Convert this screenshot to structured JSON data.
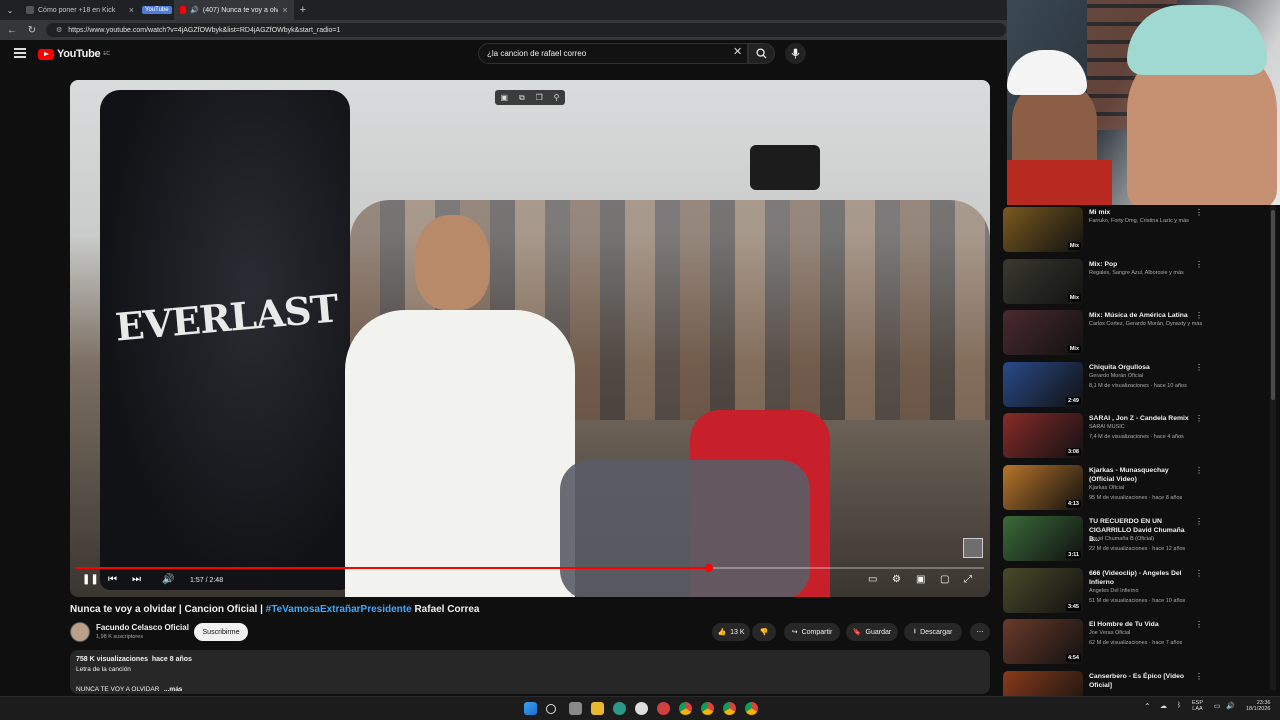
{
  "browser": {
    "tabs": [
      {
        "label": "Cómo poner +18 en Kick",
        "active": false
      },
      {
        "label": "YouTube",
        "active": false
      },
      {
        "label": "(407) Nunca te voy a olvidar |",
        "active": true
      }
    ],
    "url": "https://www.youtube.com/watch?v=4jAGZfOWbyk&list=RD4jAGZfOWbyk&start_radio=1"
  },
  "header": {
    "logo": "YouTube",
    "region": "EC",
    "search_query": "¿la cancion de rafael correo"
  },
  "player": {
    "bag_brand": "EVERLAST",
    "time_display": "1:57 / 2:48",
    "progress": 0.697
  },
  "video": {
    "title_prefix": "Nunca te voy a olvidar | Cancion Oficial | ",
    "hashtag": "#TeVamosaExtrañarPresidente",
    "title_suffix": " Rafael Correa",
    "channel": "Facundo Celasco Oficial",
    "subscribers": "1,98 K suscriptores",
    "subscribe_label": "Suscribirme",
    "likes": "13 K",
    "share_label": "Compartir",
    "save_label": "Guardar",
    "download_label": "Descargar",
    "views": "758 K visualizaciones",
    "age": "hace 8 años",
    "desc_line1": "Letra de la canción",
    "desc_line2": "NUNCA TE VOY A OLVIDAR",
    "more_label": "...más"
  },
  "recommendations": [
    {
      "title": "Mi mix",
      "channel": "Farruko, Forty Dmg, Cristina Lazic y más",
      "meta": "",
      "duration": "Mix",
      "color": "#7a5a1e"
    },
    {
      "title": "Mix: Pop",
      "channel": "Regales, Sangre Azul, Alborosie y más",
      "meta": "",
      "duration": "Mix",
      "color": "#3a3a30"
    },
    {
      "title": "Mix: Música de América Latina",
      "channel": "Carlos Cortez, Gerardo Morán, Dynasty y más",
      "meta": "",
      "duration": "Mix",
      "color": "#4a2a30"
    },
    {
      "title": "Chiquita Orgullosa",
      "channel": "Gerardo Morán Oficial",
      "meta": "8,1 M de visualizaciones · hace 10 años",
      "duration": "2:49",
      "color": "#2a4a8a"
    },
    {
      "title": "SARAI , Jon Z - Candela Remix",
      "channel": "SARAI MUSIC",
      "meta": "7,4 M de visualizaciones · hace 4 años",
      "duration": "3:08",
      "color": "#8a2a2a"
    },
    {
      "title": "Kjarkas - Munasquechay (Official Video)",
      "channel": "Kjarkas Oficial",
      "meta": "95 M de visualizaciones · hace 8 años",
      "duration": "4:13",
      "color": "#b8742a"
    },
    {
      "title": "TU RECUERDO EN UN CIGARRILLO David Chumaña B...",
      "channel": "David Chumaña B (Oficial)",
      "meta": "22 M de visualizaciones · hace 12 años",
      "duration": "3:11",
      "color": "#3a6a3a"
    },
    {
      "title": "666 (Videoclip) - Angeles Del Infierno",
      "channel": "Angeles Del Infierno",
      "meta": "51 M de visualizaciones · hace 10 años",
      "duration": "3:45",
      "color": "#4a4a2a"
    },
    {
      "title": "El Hombre de Tu Vida",
      "channel": "Joe Veras Oficial",
      "meta": "62 M de visualizaciones · hace 7 años",
      "duration": "4:54",
      "color": "#6a3a2a"
    },
    {
      "title": "Canserbero - Es Épico [Video Oficial]",
      "channel": "",
      "meta": "",
      "duration": "",
      "color": "#8a3a1a"
    }
  ],
  "taskbar": {
    "lang": "ESP",
    "lang2": "LAA",
    "time": "23:36",
    "date": "18/1/2026"
  }
}
